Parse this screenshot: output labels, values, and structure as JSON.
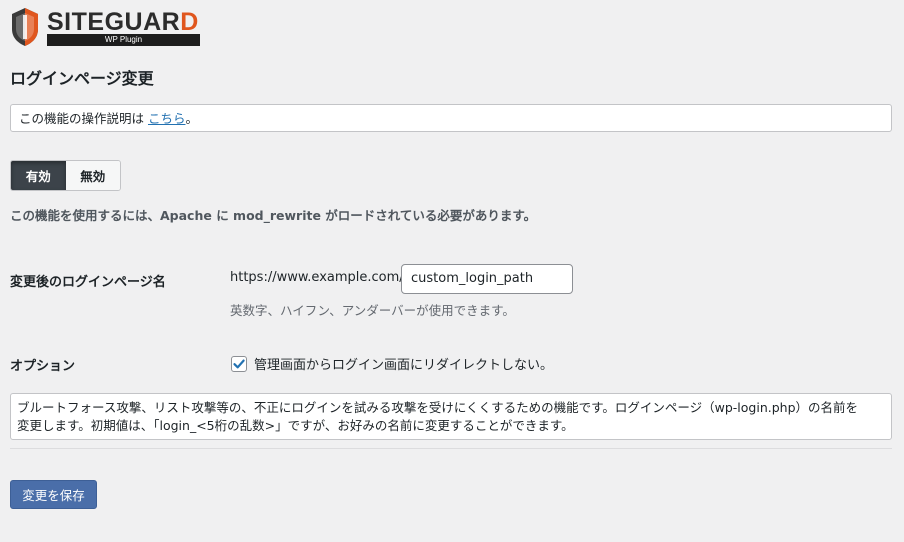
{
  "logo": {
    "name_main": "SITEGUAR",
    "name_last": "D",
    "sub": "WP Plugin",
    "brand_color": "#e0561e",
    "icon": "shield-icon"
  },
  "page_title": "ログインページ変更",
  "info": {
    "prefix": "この機能の操作説明は ",
    "link_text": "こちら",
    "suffix": "。"
  },
  "toggle": {
    "on_label": "有効",
    "off_label": "無効",
    "selected": "有効"
  },
  "notice": "この機能を使用するには、Apache に mod_rewrite がロードされている必要があります。",
  "login_page_field": {
    "label": "変更後のログインページ名",
    "url_prefix": "https://www.example.com/",
    "value": "custom_login_path",
    "hint": "英数字、ハイフン、アンダーバーが使用できます。"
  },
  "option_field": {
    "label": "オプション",
    "checkbox_label": "管理画面からログイン画面にリダイレクトしない。",
    "checked": true
  },
  "description": {
    "line1": "ブルートフォース攻撃、リスト攻撃等の、不正にログインを試みる攻撃を受けにくくするための機能です。ログインページ（wp-login.php）の名前を",
    "line2": "変更します。初期値は、「login_<5桁の乱数>」ですが、お好みの名前に変更することができます。"
  },
  "save_button": "変更を保存",
  "colors": {
    "primary_button": "#4a6ea9",
    "toggle_active": "#3c434a",
    "link": "#2271b1"
  }
}
